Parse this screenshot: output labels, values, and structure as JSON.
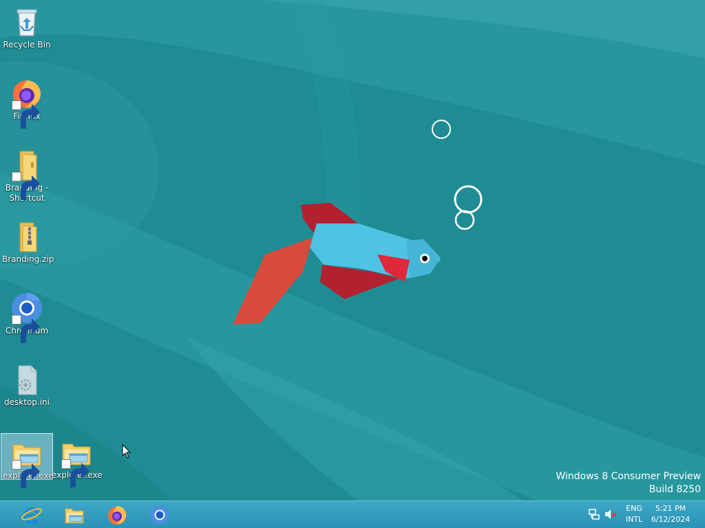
{
  "desktop": {
    "icons": [
      {
        "label": "Recycle Bin",
        "icon": "recycle-bin-icon"
      },
      {
        "label": "Firefox",
        "icon": "firefox-icon"
      },
      {
        "label": "Branding - Shortcut",
        "icon": "folder-icon"
      },
      {
        "label": "Branding.zip",
        "icon": "zip-folder-icon"
      },
      {
        "label": "Chromium",
        "icon": "chromium-icon"
      },
      {
        "label": "desktop.ini",
        "icon": "settings-file-icon"
      },
      {
        "label": "explorer.exe",
        "icon": "file-explorer-icon",
        "selected": true
      },
      {
        "label": "explorer.exe",
        "icon": "file-explorer-icon"
      }
    ]
  },
  "watermark": {
    "line1": "Windows 8 Consumer Preview",
    "line2": "Build 8250"
  },
  "taskbar": {
    "pinned": [
      {
        "icon": "internet-explorer-icon"
      },
      {
        "icon": "file-explorer-icon"
      },
      {
        "icon": "firefox-icon"
      },
      {
        "icon": "chromium-icon"
      }
    ],
    "tray": {
      "language": "ENG",
      "layout": "INTL",
      "time": "5:21 PM",
      "date": "6/12/2024"
    }
  },
  "colors": {
    "desktop_bg": "#1f8c93",
    "taskbar": "#3aa3c2",
    "fish_body": "#4fc3e3",
    "fish_fins": "#b3202f"
  }
}
